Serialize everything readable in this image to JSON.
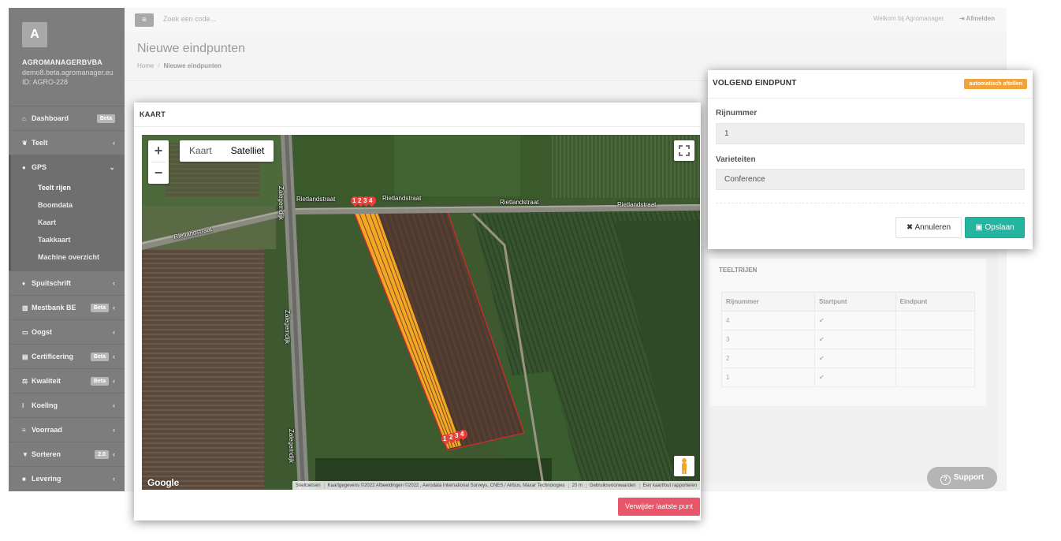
{
  "sidebar": {
    "logo_letter": "A",
    "company": "AGROMANAGERBVBA",
    "email": "demo8.beta.agromanager.eu",
    "id": "ID: AGRO-228",
    "items": [
      {
        "label": "Dashboard",
        "icon": "home-icon",
        "badge": "Beta"
      },
      {
        "label": "Teelt",
        "icon": "leaf-icon"
      },
      {
        "label": "GPS",
        "icon": "map-marker-icon",
        "expanded": true
      },
      {
        "label": "Spuitschrift",
        "icon": "drop-icon"
      },
      {
        "label": "Mestbank BE",
        "icon": "bank-icon",
        "badge": "Beta"
      },
      {
        "label": "Oogst",
        "icon": "basket-icon"
      },
      {
        "label": "Certificering",
        "icon": "book-icon",
        "badge": "Beta"
      },
      {
        "label": "Kwaliteit",
        "icon": "balance-icon",
        "badge": "Beta"
      },
      {
        "label": "Koeling",
        "icon": "thermometer-icon"
      },
      {
        "label": "Voorraad",
        "icon": "list-icon"
      },
      {
        "label": "Sorteren",
        "icon": "filter-icon",
        "badge": "2.0"
      },
      {
        "label": "Levering",
        "icon": "truck-icon"
      }
    ],
    "gps_subitems": [
      "Teelt rijen",
      "Boomdata",
      "Kaart",
      "Taakkaart",
      "Machine overzicht"
    ]
  },
  "topbar": {
    "search_placeholder": "Zoek een code...",
    "welcome": "Welkom bij Agromanager.",
    "logout": "Afmelden"
  },
  "page": {
    "title": "Nieuwe eindpunten",
    "breadcrumb_home": "Home",
    "breadcrumb_current": "Nieuwe eindpunten"
  },
  "map_modal": {
    "title": "KAART",
    "maptype_options": [
      "Kaart",
      "Satelliet"
    ],
    "selected_maptype": "Satelliet",
    "streets": [
      "Rietlandstraat",
      "Rietlandstraat",
      "Rietlandstraat",
      "Rietlandstraat",
      "Zalegemdijk",
      "Zalegemdijk",
      "Zalegemdijk"
    ],
    "marker_labels_top": [
      "1",
      "2",
      "3",
      "4"
    ],
    "marker_labels_bottom": [
      "1",
      "2",
      "3",
      "4"
    ],
    "google_logo": "Google",
    "attribution": [
      "Sneltoetsen",
      "Kaartgegevens ©2022 Afbeeldingen ©2022 , Aerodata International Surveys, CNES / Airbus, Maxar Technologies",
      "20 m",
      "Gebruiksvoorwaarden",
      "Een kaartfout rapporteren"
    ],
    "delete_button": "Verwijder laatste punt",
    "colors": {
      "marker": "#e8403a",
      "rows": "#f5a623",
      "field_border": "#d42a2a"
    }
  },
  "endpoint_modal": {
    "title": "VOLGEND EINDPUNT",
    "badge": "automatisch aftellen",
    "row_label": "Rijnummer",
    "row_value": "1",
    "variety_label": "Varieteiten",
    "variety_value": "Conference",
    "cancel": "Annuleren",
    "save": "Opslaan"
  },
  "teeltrijen": {
    "title": "TEELTRIJEN",
    "columns": [
      "Rijnummer",
      "Startpunt",
      "Eindpunt"
    ],
    "rows": [
      {
        "nr": "4",
        "start": "✔",
        "end": ""
      },
      {
        "nr": "3",
        "start": "✔",
        "end": ""
      },
      {
        "nr": "2",
        "start": "✔",
        "end": ""
      },
      {
        "nr": "1",
        "start": "✔",
        "end": ""
      }
    ]
  },
  "support": "Support"
}
